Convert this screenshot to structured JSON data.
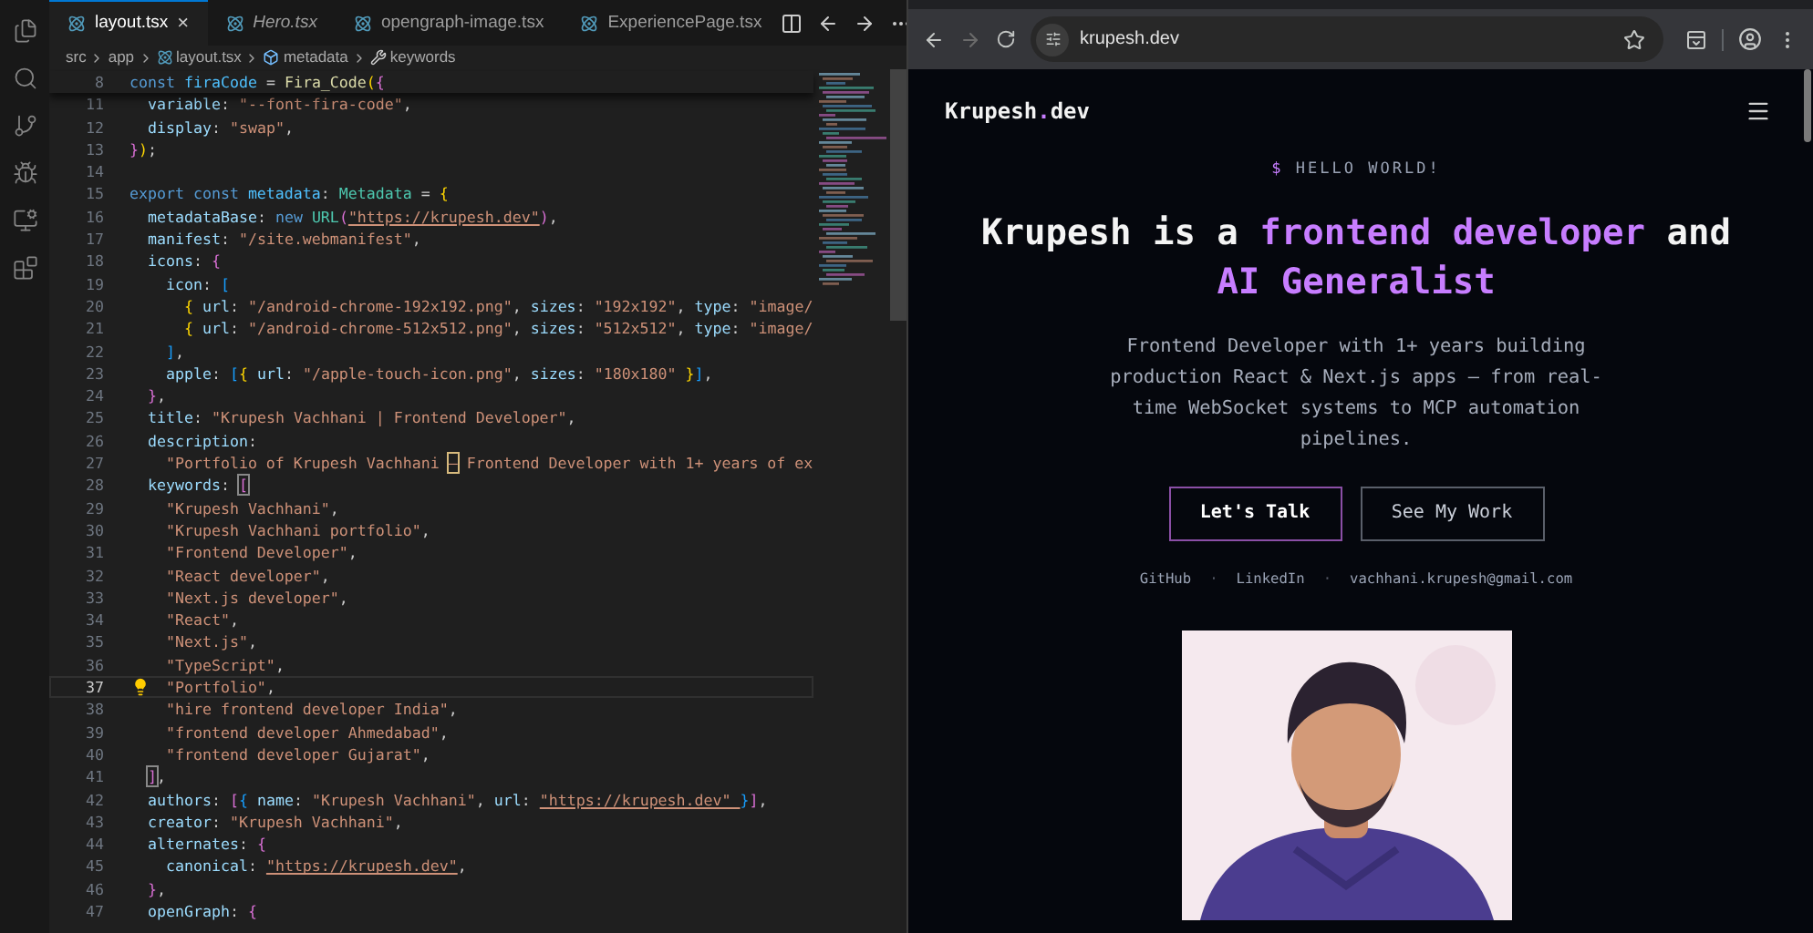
{
  "editor": {
    "tabs": [
      {
        "label": "layout.tsx",
        "selected": true,
        "italic": false,
        "closable": true,
        "close": "×"
      },
      {
        "label": "Hero.tsx",
        "selected": false,
        "italic": true,
        "closable": false
      },
      {
        "label": "opengraph-image.tsx",
        "selected": false,
        "italic": false,
        "closable": false
      },
      {
        "label": "ExperiencePage.tsx",
        "selected": false,
        "italic": false,
        "closable": false
      }
    ],
    "breadcrumb": [
      {
        "text": "src",
        "kind": "folder"
      },
      {
        "text": "app",
        "kind": "folder"
      },
      {
        "text": "layout.tsx",
        "kind": "file"
      },
      {
        "text": "metadata",
        "kind": "variable"
      },
      {
        "text": "keywords",
        "kind": "property"
      }
    ],
    "sticky_line": {
      "number": "8",
      "tokens": [
        {
          "text": "const ",
          "kind": "keyword"
        },
        {
          "text": "firaCode",
          "kind": "variable"
        },
        {
          "text": " = ",
          "kind": "punct"
        },
        {
          "text": "Fira_Code",
          "kind": "function"
        },
        {
          "text": "(",
          "kind": "bracket1"
        },
        {
          "text": "{",
          "kind": "bracket2"
        }
      ]
    },
    "lines": [
      {
        "number": "11",
        "current": false,
        "tokens": [
          {
            "text": "  variable",
            "kind": "property"
          },
          {
            "text": ": ",
            "kind": "punct"
          },
          {
            "text": "\"--font-fira-code\"",
            "kind": "string"
          },
          {
            "text": ",",
            "kind": "punct"
          }
        ]
      },
      {
        "number": "12",
        "current": false,
        "tokens": [
          {
            "text": "  display",
            "kind": "property"
          },
          {
            "text": ": ",
            "kind": "punct"
          },
          {
            "text": "\"swap\"",
            "kind": "string"
          },
          {
            "text": ",",
            "kind": "punct"
          }
        ]
      },
      {
        "number": "13",
        "current": false,
        "tokens": [
          {
            "text": "}",
            "kind": "bracket2"
          },
          {
            "text": ")",
            "kind": "bracket1"
          },
          {
            "text": ";",
            "kind": "punct"
          }
        ]
      },
      {
        "number": "14",
        "current": false
      },
      {
        "number": "15",
        "current": false,
        "tokens": [
          {
            "text": "export const ",
            "kind": "keyword"
          },
          {
            "text": "metadata",
            "kind": "variable"
          },
          {
            "text": ": ",
            "kind": "punct"
          },
          {
            "text": "Metadata",
            "kind": "type"
          },
          {
            "text": " = ",
            "kind": "punct"
          },
          {
            "text": "{",
            "kind": "bracket1"
          }
        ]
      },
      {
        "number": "16",
        "current": false,
        "tokens": [
          {
            "text": "  metadataBase",
            "kind": "property"
          },
          {
            "text": ": ",
            "kind": "punct"
          },
          {
            "text": "new ",
            "kind": "keyword"
          },
          {
            "text": "URL",
            "kind": "type"
          },
          {
            "text": "(",
            "kind": "bracket2"
          },
          {
            "text": "\"https://krupesh.dev\"",
            "kind": "link"
          },
          {
            "text": ")",
            "kind": "bracket2"
          },
          {
            "text": ",",
            "kind": "punct"
          }
        ]
      },
      {
        "number": "17",
        "current": false,
        "tokens": [
          {
            "text": "  manifest",
            "kind": "property"
          },
          {
            "text": ": ",
            "kind": "punct"
          },
          {
            "text": "\"/site.webmanifest\"",
            "kind": "string"
          },
          {
            "text": ",",
            "kind": "punct"
          }
        ]
      },
      {
        "number": "18",
        "current": false,
        "tokens": [
          {
            "text": "  icons",
            "kind": "property"
          },
          {
            "text": ": ",
            "kind": "punct"
          },
          {
            "text": "{",
            "kind": "bracket2"
          }
        ]
      },
      {
        "number": "19",
        "current": false,
        "tokens": [
          {
            "text": "    icon",
            "kind": "property"
          },
          {
            "text": ": ",
            "kind": "punct"
          },
          {
            "text": "[",
            "kind": "bracket3"
          }
        ]
      },
      {
        "number": "20",
        "current": false,
        "tokens": [
          {
            "text": "      {",
            "kind": "bracket1"
          },
          {
            "text": " url",
            "kind": "property"
          },
          {
            "text": ": ",
            "kind": "punct"
          },
          {
            "text": "\"/android-chrome-192x192.png\"",
            "kind": "string"
          },
          {
            "text": ", ",
            "kind": "punct"
          },
          {
            "text": "sizes",
            "kind": "property"
          },
          {
            "text": ": ",
            "kind": "punct"
          },
          {
            "text": "\"192x192\"",
            "kind": "string"
          },
          {
            "text": ", ",
            "kind": "punct"
          },
          {
            "text": "type",
            "kind": "property"
          },
          {
            "text": ": ",
            "kind": "punct"
          },
          {
            "text": "\"image/",
            "kind": "string"
          }
        ]
      },
      {
        "number": "21",
        "current": false,
        "tokens": [
          {
            "text": "      {",
            "kind": "bracket1"
          },
          {
            "text": " url",
            "kind": "property"
          },
          {
            "text": ": ",
            "kind": "punct"
          },
          {
            "text": "\"/android-chrome-512x512.png\"",
            "kind": "string"
          },
          {
            "text": ", ",
            "kind": "punct"
          },
          {
            "text": "sizes",
            "kind": "property"
          },
          {
            "text": ": ",
            "kind": "punct"
          },
          {
            "text": "\"512x512\"",
            "kind": "string"
          },
          {
            "text": ", ",
            "kind": "punct"
          },
          {
            "text": "type",
            "kind": "property"
          },
          {
            "text": ": ",
            "kind": "punct"
          },
          {
            "text": "\"image/",
            "kind": "string"
          }
        ]
      },
      {
        "number": "22",
        "current": false,
        "tokens": [
          {
            "text": "    ]",
            "kind": "bracket3"
          },
          {
            "text": ",",
            "kind": "punct"
          }
        ]
      },
      {
        "number": "23",
        "current": false,
        "tokens": [
          {
            "text": "    apple",
            "kind": "property"
          },
          {
            "text": ": ",
            "kind": "punct"
          },
          {
            "text": "[",
            "kind": "bracket3"
          },
          {
            "text": "{",
            "kind": "bracket1"
          },
          {
            "text": " url",
            "kind": "property"
          },
          {
            "text": ": ",
            "kind": "punct"
          },
          {
            "text": "\"/apple-touch-icon.png\"",
            "kind": "string"
          },
          {
            "text": ", ",
            "kind": "punct"
          },
          {
            "text": "sizes",
            "kind": "property"
          },
          {
            "text": ": ",
            "kind": "punct"
          },
          {
            "text": "\"180x180\" ",
            "kind": "string"
          },
          {
            "text": "}",
            "kind": "bracket1"
          },
          {
            "text": "]",
            "kind": "bracket3"
          },
          {
            "text": ",",
            "kind": "punct"
          }
        ]
      },
      {
        "number": "24",
        "current": false,
        "tokens": [
          {
            "text": "  }",
            "kind": "bracket2"
          },
          {
            "text": ",",
            "kind": "punct"
          }
        ]
      },
      {
        "number": "25",
        "current": false,
        "tokens": [
          {
            "text": "  title",
            "kind": "property"
          },
          {
            "text": ": ",
            "kind": "punct"
          },
          {
            "text": "\"Krupesh Vachhani | Frontend Developer\"",
            "kind": "string"
          },
          {
            "text": ",",
            "kind": "punct"
          }
        ]
      },
      {
        "number": "26",
        "current": false,
        "tokens": [
          {
            "text": "  description",
            "kind": "property"
          },
          {
            "text": ":",
            "kind": "punct"
          }
        ]
      },
      {
        "number": "27",
        "current": false,
        "tokens": [
          {
            "text": "    \"Portfolio of Krupesh Vachhani ",
            "kind": "string"
          },
          {
            "text": "–",
            "kind": "highlight"
          },
          {
            "text": " Frontend Developer with 1+ years of ex",
            "kind": "string"
          }
        ]
      },
      {
        "number": "28",
        "current": false,
        "tokens": [
          {
            "text": "  keywords",
            "kind": "property"
          },
          {
            "text": ": ",
            "kind": "punct"
          },
          {
            "text": "[",
            "kind": "match"
          }
        ]
      },
      {
        "number": "29",
        "current": false,
        "tokens": [
          {
            "text": "    \"Krupesh Vachhani\"",
            "kind": "string"
          },
          {
            "text": ",",
            "kind": "punct"
          }
        ]
      },
      {
        "number": "30",
        "current": false,
        "tokens": [
          {
            "text": "    \"Krupesh Vachhani portfolio\"",
            "kind": "string"
          },
          {
            "text": ",",
            "kind": "punct"
          }
        ]
      },
      {
        "number": "31",
        "current": false,
        "tokens": [
          {
            "text": "    \"Frontend Developer\"",
            "kind": "string"
          },
          {
            "text": ",",
            "kind": "punct"
          }
        ]
      },
      {
        "number": "32",
        "current": false,
        "tokens": [
          {
            "text": "    \"React developer\"",
            "kind": "string"
          },
          {
            "text": ",",
            "kind": "punct"
          }
        ]
      },
      {
        "number": "33",
        "current": false,
        "tokens": [
          {
            "text": "    \"Next.js developer\"",
            "kind": "string"
          },
          {
            "text": ",",
            "kind": "punct"
          }
        ]
      },
      {
        "number": "34",
        "current": false,
        "tokens": [
          {
            "text": "    \"React\"",
            "kind": "string"
          },
          {
            "text": ",",
            "kind": "punct"
          }
        ]
      },
      {
        "number": "35",
        "current": false,
        "tokens": [
          {
            "text": "    \"Next.js\"",
            "kind": "string"
          },
          {
            "text": ",",
            "kind": "punct"
          }
        ]
      },
      {
        "number": "36",
        "current": false,
        "tokens": [
          {
            "text": "    \"TypeScript\"",
            "kind": "string"
          },
          {
            "text": ",",
            "kind": "punct"
          }
        ]
      },
      {
        "number": "37",
        "current": true,
        "tokens": [
          {
            "text": "    \"Portfolio\"",
            "kind": "string"
          },
          {
            "text": ",",
            "kind": "punct"
          }
        ]
      },
      {
        "number": "38",
        "current": false,
        "tokens": [
          {
            "text": "    \"hire frontend developer India\"",
            "kind": "string"
          },
          {
            "text": ",",
            "kind": "punct"
          }
        ]
      },
      {
        "number": "39",
        "current": false,
        "tokens": [
          {
            "text": "    \"frontend developer Ahmedabad\"",
            "kind": "string"
          },
          {
            "text": ",",
            "kind": "punct"
          }
        ]
      },
      {
        "number": "40",
        "current": false,
        "tokens": [
          {
            "text": "    \"frontend developer Gujarat\"",
            "kind": "string"
          },
          {
            "text": ",",
            "kind": "punct"
          }
        ]
      },
      {
        "number": "41",
        "current": false,
        "tokens": [
          {
            "text": "  ]",
            "kind": "match"
          },
          {
            "text": ",",
            "kind": "punct"
          }
        ]
      },
      {
        "number": "42",
        "current": false,
        "tokens": [
          {
            "text": "  authors",
            "kind": "property"
          },
          {
            "text": ": ",
            "kind": "punct"
          },
          {
            "text": "[",
            "kind": "bracket2"
          },
          {
            "text": "{",
            "kind": "bracket3"
          },
          {
            "text": " name",
            "kind": "property"
          },
          {
            "text": ": ",
            "kind": "punct"
          },
          {
            "text": "\"Krupesh Vachhani\"",
            "kind": "string"
          },
          {
            "text": ", ",
            "kind": "punct"
          },
          {
            "text": "url",
            "kind": "property"
          },
          {
            "text": ": ",
            "kind": "punct"
          },
          {
            "text": "\"https://krupesh.dev\" ",
            "kind": "link"
          },
          {
            "text": "}",
            "kind": "bracket3"
          },
          {
            "text": "]",
            "kind": "bracket2"
          },
          {
            "text": ",",
            "kind": "punct"
          }
        ]
      },
      {
        "number": "43",
        "current": false,
        "tokens": [
          {
            "text": "  creator",
            "kind": "property"
          },
          {
            "text": ": ",
            "kind": "punct"
          },
          {
            "text": "\"Krupesh Vachhani\"",
            "kind": "string"
          },
          {
            "text": ",",
            "kind": "punct"
          }
        ]
      },
      {
        "number": "44",
        "current": false,
        "tokens": [
          {
            "text": "  alternates",
            "kind": "property"
          },
          {
            "text": ": ",
            "kind": "punct"
          },
          {
            "text": "{",
            "kind": "bracket2"
          }
        ]
      },
      {
        "number": "45",
        "current": false,
        "tokens": [
          {
            "text": "    canonical",
            "kind": "property"
          },
          {
            "text": ": ",
            "kind": "punct"
          },
          {
            "text": "\"https://krupesh.dev\"",
            "kind": "link"
          },
          {
            "text": ",",
            "kind": "punct"
          }
        ]
      },
      {
        "number": "46",
        "current": false,
        "tokens": [
          {
            "text": "  }",
            "kind": "bracket2"
          },
          {
            "text": ",",
            "kind": "punct"
          }
        ]
      },
      {
        "number": "47",
        "current": false,
        "tokens": [
          {
            "text": "  openGraph",
            "kind": "property"
          },
          {
            "text": ": ",
            "kind": "punct"
          },
          {
            "text": "{",
            "kind": "bracket2"
          }
        ]
      }
    ]
  },
  "browser": {
    "back_disabled": false,
    "forward_disabled": true,
    "url": "krupesh.dev",
    "page": {
      "logo": [
        {
          "text": "Krupesh",
          "accent": false
        },
        {
          "text": ".",
          "accent": true
        },
        {
          "text": "dev",
          "accent": false
        }
      ],
      "prompt": {
        "symbol": "$",
        "text": "HELLO WORLD!"
      },
      "heading": [
        {
          "text": "Krupesh is a ",
          "accent": false
        },
        {
          "text": "frontend developer",
          "accent": true
        },
        {
          "text": " and ",
          "accent": false
        },
        {
          "text": "AI Generalist",
          "accent": true
        }
      ],
      "intro": "Frontend Developer with 1+ years building production React & Next.js apps — from real-time WebSocket systems to MCP automation pipelines.",
      "buttons": [
        {
          "label": "Let's Talk",
          "kind": "primary"
        },
        {
          "label": "See My Work",
          "kind": "secondary"
        }
      ],
      "contact_row": [
        {
          "text": "GitHub",
          "kind": "link"
        },
        {
          "text": "·",
          "kind": "separator"
        },
        {
          "text": "LinkedIn",
          "kind": "link"
        },
        {
          "text": "·",
          "kind": "separator"
        },
        {
          "text": "vachhani.krupesh@gmail.com",
          "kind": "link"
        }
      ]
    }
  }
}
